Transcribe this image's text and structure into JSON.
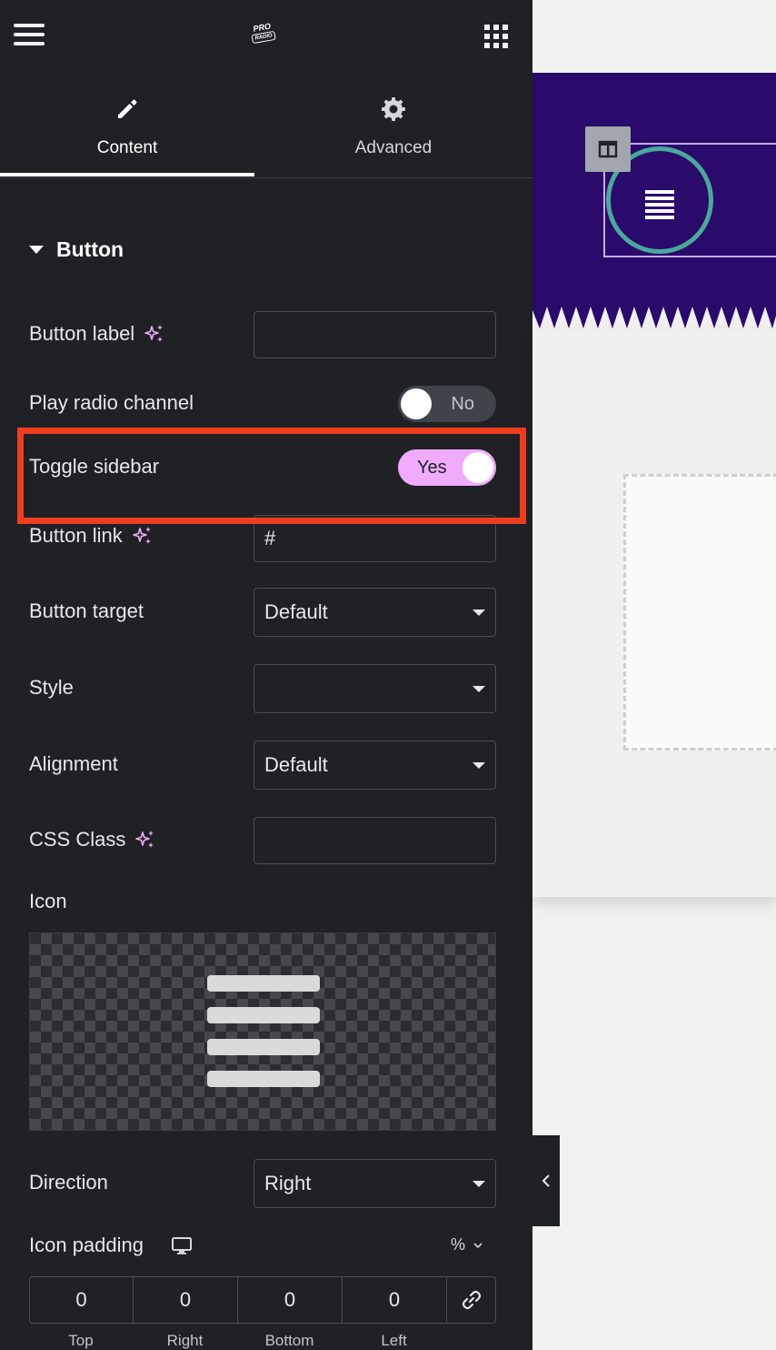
{
  "topbar": {
    "logo_line1": "PRO",
    "logo_line2": "RADIO"
  },
  "tabs": [
    {
      "label": "Content",
      "icon": "pencil-icon",
      "active": true
    },
    {
      "label": "Advanced",
      "icon": "gear-icon",
      "active": false
    }
  ],
  "section": {
    "title": "Button",
    "expanded": true
  },
  "fields": {
    "button_label": {
      "label": "Button label",
      "value": ""
    },
    "play_radio": {
      "label": "Play radio channel",
      "state": "No"
    },
    "toggle_sidebar": {
      "label": "Toggle sidebar",
      "state": "Yes"
    },
    "button_link": {
      "label": "Button link",
      "value": "#"
    },
    "button_target": {
      "label": "Button target",
      "value": "Default"
    },
    "style": {
      "label": "Style",
      "value": ""
    },
    "alignment": {
      "label": "Alignment",
      "value": "Default"
    },
    "css_class": {
      "label": "CSS Class",
      "value": ""
    },
    "icon": {
      "label": "Icon",
      "preview_icon": "menu-lines-icon"
    },
    "direction": {
      "label": "Direction",
      "value": "Right"
    },
    "icon_padding": {
      "label": "Icon padding",
      "unit": "%",
      "values": {
        "top": "0",
        "right": "0",
        "bottom": "0",
        "left": "0"
      },
      "labels": {
        "top": "Top",
        "right": "Right",
        "bottom": "Bottom",
        "left": "Left"
      }
    }
  },
  "colors": {
    "panel_bg": "#1f2124",
    "accent": "#f0abfc",
    "highlight": "#f03d20",
    "canvas_header": "#2a0a6a",
    "circle_border": "#4aa89d"
  }
}
